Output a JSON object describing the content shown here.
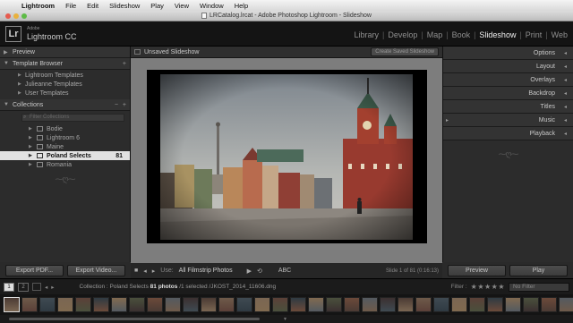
{
  "menubar": {
    "items": [
      "Lightroom",
      "File",
      "Edit",
      "Slideshow",
      "Play",
      "View",
      "Window",
      "Help"
    ]
  },
  "window": {
    "title": "LRCatalog.lrcat - Adobe Photoshop Lightroom - Slideshow"
  },
  "identity": {
    "logo": "Lr",
    "adobe": "Adobe",
    "product": "Lightroom CC"
  },
  "modules": {
    "items": [
      "Library",
      "Develop",
      "Map",
      "Book",
      "Slideshow",
      "Print",
      "Web"
    ],
    "active": "Slideshow"
  },
  "left_panel": {
    "preview": "Preview",
    "template_browser": {
      "title": "Template Browser",
      "items": [
        "Lightroom Templates",
        "Julieanne Templates",
        "User Templates"
      ]
    },
    "collections": {
      "title": "Collections",
      "search_placeholder": "Filter Collections",
      "items": [
        {
          "label": "Bodie",
          "count": ""
        },
        {
          "label": "Lightroom 6",
          "count": ""
        },
        {
          "label": "Maine",
          "count": ""
        },
        {
          "label": "Poland Selects",
          "count": "81"
        },
        {
          "label": "Romania",
          "count": ""
        }
      ],
      "selected": "Poland Selects"
    },
    "export_pdf": "Export PDF...",
    "export_video": "Export Video..."
  },
  "center": {
    "slideshow_name": "Unsaved Slideshow",
    "save_button": "Create Saved Slideshow",
    "toolbar": {
      "use_label": "Use:",
      "use_value": "All Filmstrip Photos",
      "abc": "ABC",
      "slide_info": "Slide 1 of 81 (0:16:13)"
    }
  },
  "right_panel": {
    "sections": [
      "Options",
      "Layout",
      "Overlays",
      "Backdrop",
      "Titles",
      "Music",
      "Playback"
    ],
    "preview_button": "Preview",
    "play_button": "Play"
  },
  "filmstrip": {
    "page_1": "1",
    "page_2": "2",
    "source_path": "Collection : Poland Selects",
    "photo_count": "81 photos",
    "selection": "/1 selected /JKOST_2014_11606.dng",
    "filter_label": "Filter :",
    "filter_value": "No Filter",
    "thumb_count": 33
  },
  "colors": {
    "accent": "#f0f0f0",
    "panel": "#2c2c2c",
    "background": "#7d7d7d"
  }
}
